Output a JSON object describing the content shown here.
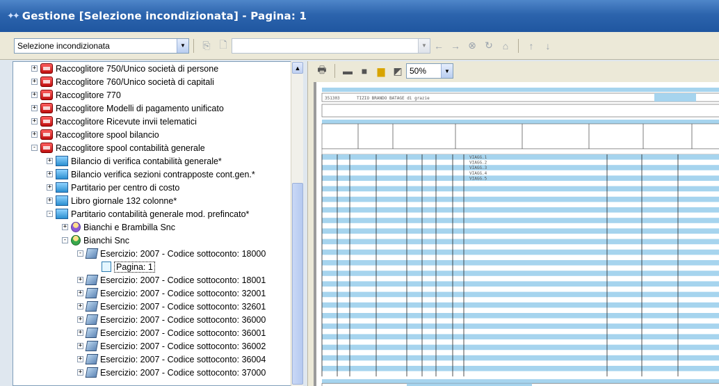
{
  "window": {
    "title": "Gestione [Selezione incondizionata] - Pagina: 1"
  },
  "toolbar": {
    "selection_value": "Selezione incondizionata"
  },
  "viewer": {
    "zoom_value": "50%"
  },
  "tree": {
    "items": [
      {
        "label": "Raccoglitore 750/Unico società di persone",
        "level": 0,
        "expander": "+",
        "icon": "binder-icon"
      },
      {
        "label": "Raccoglitore 760/Unico società di capitali",
        "level": 0,
        "expander": "+",
        "icon": "binder-icon"
      },
      {
        "label": "Raccoglitore 770",
        "level": 0,
        "expander": "+",
        "icon": "binder-icon"
      },
      {
        "label": "Raccoglitore Modelli di pagamento unificato",
        "level": 0,
        "expander": "+",
        "icon": "binder-icon"
      },
      {
        "label": "Raccoglitore Ricevute invii telematici",
        "level": 0,
        "expander": "+",
        "icon": "binder-icon"
      },
      {
        "label": "Raccoglitore spool bilancio",
        "level": 0,
        "expander": "+",
        "icon": "binder-icon"
      },
      {
        "label": "Raccoglitore spool contabilità generale",
        "level": 0,
        "expander": "-",
        "icon": "binder-icon"
      },
      {
        "label": "Bilancio di verifica contabilità generale*",
        "level": 1,
        "expander": "+",
        "icon": "folder-icon"
      },
      {
        "label": "Bilancio verifica sezioni contrapposte cont.gen.*",
        "level": 1,
        "expander": "+",
        "icon": "folder-icon"
      },
      {
        "label": "Partitario per centro di costo",
        "level": 1,
        "expander": "+",
        "icon": "folder-icon"
      },
      {
        "label": "Libro giornale 132 colonne*",
        "level": 1,
        "expander": "+",
        "icon": "folder-icon"
      },
      {
        "label": "Partitario contabilità generale mod. prefincato*",
        "level": 1,
        "expander": "-",
        "icon": "folder-icon"
      },
      {
        "label": "Bianchi e Brambilla Snc",
        "level": 2,
        "expander": "+",
        "icon": "person-icon"
      },
      {
        "label": "Bianchi Snc",
        "level": 2,
        "expander": "-",
        "icon": "person-icon"
      },
      {
        "label": "Esercizio: 2007 - Codice sottoconto: 18000",
        "level": 3,
        "expander": "-",
        "icon": "tag-icon"
      },
      {
        "label": "Pagina: 1",
        "level": 4,
        "expander": "",
        "icon": "page-icon",
        "selected": true
      },
      {
        "label": "Esercizio: 2007 - Codice sottoconto: 18001",
        "level": 3,
        "expander": "+",
        "icon": "tag-icon"
      },
      {
        "label": "Esercizio: 2007 - Codice sottoconto: 32001",
        "level": 3,
        "expander": "+",
        "icon": "tag-icon"
      },
      {
        "label": "Esercizio: 2007 - Codice sottoconto: 32601",
        "level": 3,
        "expander": "+",
        "icon": "tag-icon"
      },
      {
        "label": "Esercizio: 2007 - Codice sottoconto: 36000",
        "level": 3,
        "expander": "+",
        "icon": "tag-icon"
      },
      {
        "label": "Esercizio: 2007 - Codice sottoconto: 36001",
        "level": 3,
        "expander": "+",
        "icon": "tag-icon"
      },
      {
        "label": "Esercizio: 2007 - Codice sottoconto: 36002",
        "level": 3,
        "expander": "+",
        "icon": "tag-icon"
      },
      {
        "label": "Esercizio: 2007 - Codice sottoconto: 36004",
        "level": 3,
        "expander": "+",
        "icon": "tag-icon"
      },
      {
        "label": "Esercizio: 2007 - Codice sottoconto: 37000",
        "level": 3,
        "expander": "+",
        "icon": "tag-icon"
      }
    ]
  },
  "document": {
    "header_code": "351303",
    "header_name": "TIZIO BRANDO BATAGE di grazie",
    "row_labels": [
      "VIAGG.1",
      "VIAGG.2",
      "VIAGG.3",
      "VIAGG.4",
      "VIAGG.5"
    ]
  },
  "colors": {
    "accent": "#2c64ad",
    "doc_stripe": "#a6d4ee"
  }
}
